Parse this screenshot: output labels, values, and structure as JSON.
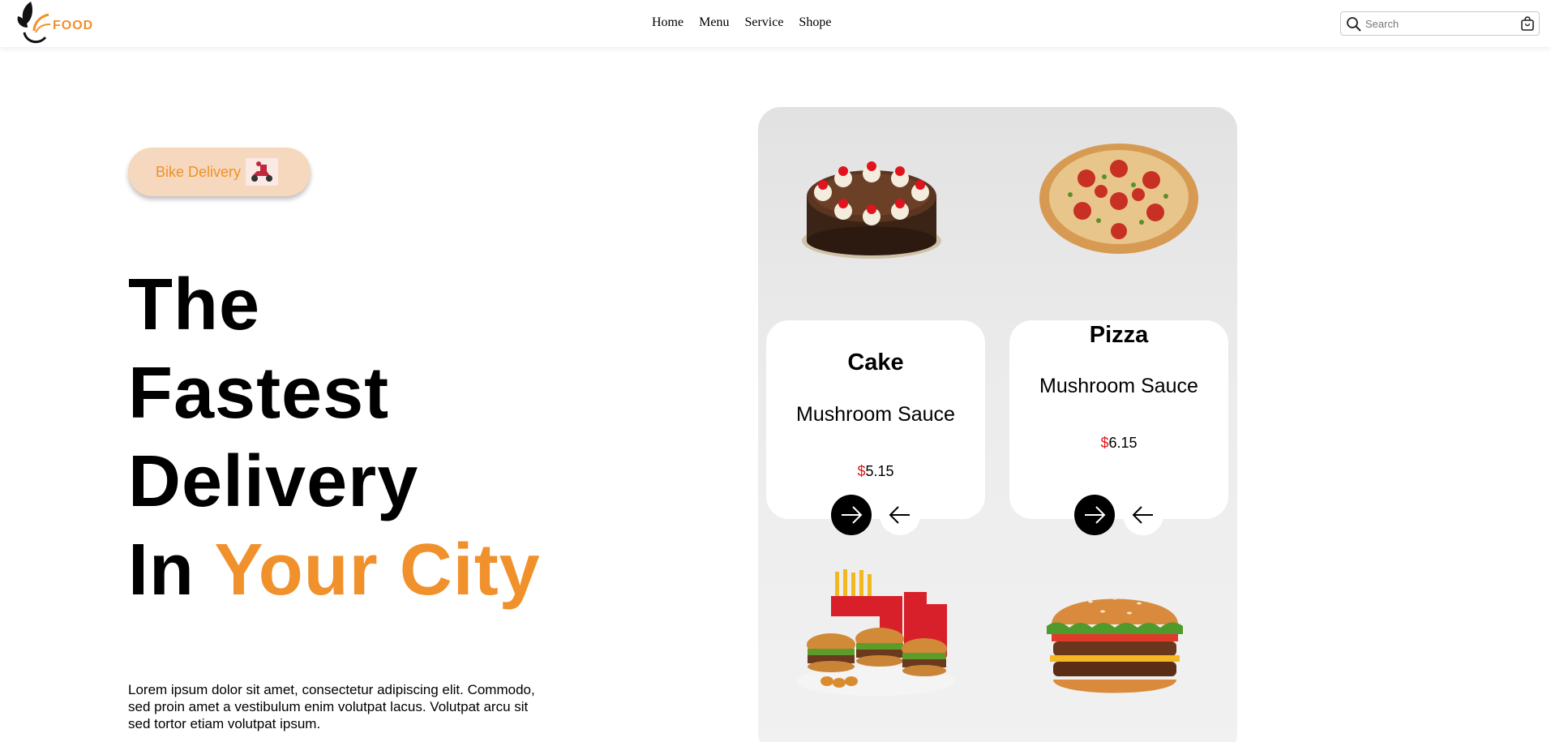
{
  "header": {
    "logo_text": "FOOD",
    "nav": [
      "Home",
      "Menu",
      "Service",
      "Shope"
    ],
    "search_placeholder": "Search"
  },
  "badge": {
    "label": "Bike Delivery"
  },
  "hero": {
    "line1": "The",
    "line2": "Fastest",
    "line3": "Delivery",
    "line4_prefix": "In ",
    "line4_accent": "Your City",
    "description": "Lorem ipsum dolor sit amet, consectetur adipiscing elit. Commodo, sed proin amet a vestibulum enim volutpat lacus. Volutpat arcu sit sed tortor etiam volutpat ipsum."
  },
  "cards": [
    {
      "name": "Cake",
      "subtitle": "Mushroom Sauce",
      "currency": "$",
      "price": "5.15"
    },
    {
      "name": "Pizza",
      "subtitle": "Mushroom Sauce",
      "currency": "$",
      "price": "6.15"
    }
  ],
  "colors": {
    "accent": "#f0912c",
    "price_currency": "#e01818",
    "badge_bg": "#f5d8bd"
  }
}
